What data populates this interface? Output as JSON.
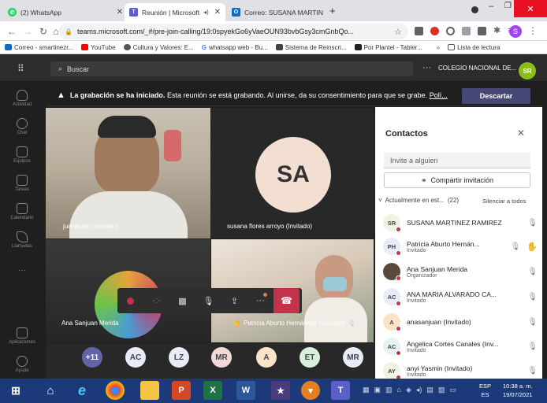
{
  "browser": {
    "tabs": [
      {
        "label": "(2) WhatsApp",
        "icon": "whatsapp-icon"
      },
      {
        "label": "Reunión | Microsoft",
        "icon": "teams-icon"
      },
      {
        "label": "Correo: SUSANA MARTIN",
        "icon": "outlook-icon"
      }
    ],
    "url": "teams.microsoft.com/_#/pre-join-calling/19:0spyekGo6yVaeOUN93bvbGsy3cmGnbQo...",
    "bookmarks": [
      "Correo - smartinezr...",
      "YouTube",
      "Cultura y Valores: E...",
      "whatsapp web - Bu...",
      "Sistema de Reinscri...",
      "Por Plantel - Tabler...",
      "Lista de lectura"
    ],
    "profile_initial": "S"
  },
  "teams": {
    "search_placeholder": "Buscar",
    "org": "COLEGIO NACIONAL DE...",
    "user_initials": "SR",
    "rail": [
      "Actividad",
      "Chat",
      "Equipos",
      "Tareas",
      "Calendario",
      "Llamadas",
      "Aplicaciones",
      "Ayuda"
    ],
    "banner": {
      "bold": "La grabación se ha iniciado.",
      "text": "Esta reunión se está grabando. Al unirse, da su consentimiento para que se grabe.",
      "link": "Polí...",
      "button": "Descartar"
    },
    "tiles": {
      "t1": "juanjsuan (Invitado)",
      "t2_initials": "SA",
      "t2": "susana flores arroyo (Invitado)",
      "t3": "Ana Sanjuan Merida",
      "t4": "Patricia Aburto Hernández (Invitado)"
    },
    "overflow": [
      {
        "label": "+11",
        "color": "#6264a7",
        "text": "#ffffff"
      },
      {
        "label": "AC",
        "color": "#e8ebfa",
        "text": "#444444"
      },
      {
        "label": "LZ",
        "color": "#e8ebfa",
        "text": "#444444"
      },
      {
        "label": "MR",
        "color": "#f4d8d8",
        "text": "#444444"
      },
      {
        "label": "A",
        "color": "#fbe3c8",
        "text": "#444444"
      },
      {
        "label": "ET",
        "color": "#d8f0dc",
        "text": "#444444"
      },
      {
        "label": "MR",
        "color": "#e8ebfa",
        "text": "#444444"
      }
    ],
    "contacts": {
      "title": "Contactos",
      "invite_placeholder": "Invite a alguien",
      "share": "Compartir invitación",
      "section": "Actualmente en est...",
      "count": "(22)",
      "mute_all": "Silenciar a todos",
      "people": [
        {
          "initials": "SR",
          "name": "SUSANA MARTINEZ RAMIREZ",
          "role": "",
          "color": "#eef4e2"
        },
        {
          "initials": "PH",
          "name": "Patricia Aburto Hernán...",
          "role": "Invitado",
          "color": "#e8ebfa"
        },
        {
          "initials": "",
          "name": "Ana Sanjuan Merida",
          "role": "Organizador",
          "color": "#5a4a3a"
        },
        {
          "initials": "AC",
          "name": "ANA MARIA ALVARADO CA...",
          "role": "Invitado",
          "color": "#e8ebfa"
        },
        {
          "initials": "A",
          "name": "anasanjuan (Invitado)",
          "role": "",
          "color": "#fbe3c8"
        },
        {
          "initials": "AC",
          "name": "Angelica Cortes Canales (Inv...",
          "role": "Invitado",
          "color": "#e6f3f3"
        },
        {
          "initials": "AY",
          "name": "anyi Yasmin (Invitado)",
          "role": "Invitado",
          "color": "#eef4e2"
        }
      ]
    }
  },
  "taskbar": {
    "lang": "ESP",
    "lang2": "ES",
    "time": "10:38 a. m.",
    "date": "19/07/2021"
  }
}
